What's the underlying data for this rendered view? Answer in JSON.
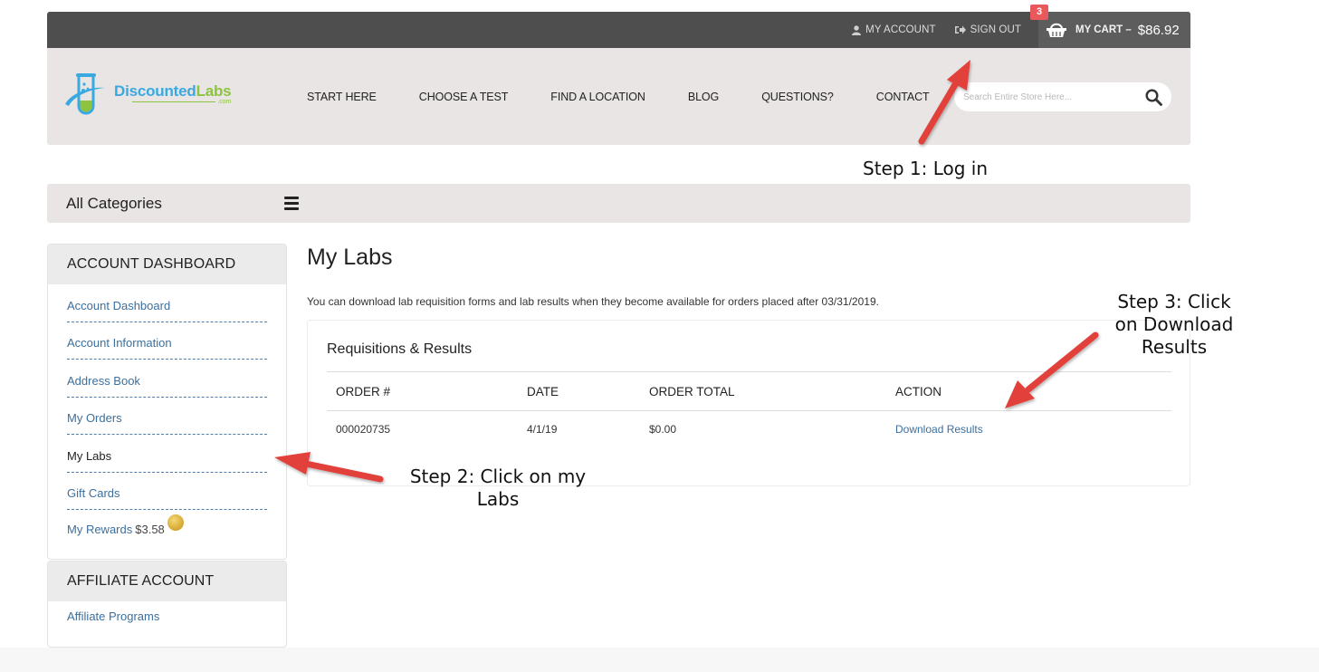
{
  "topbar": {
    "my_account": "MY ACCOUNT",
    "sign_out": "SIGN OUT",
    "cart_label": "MY CART –",
    "cart_total": "$86.92",
    "cart_count": "3"
  },
  "header": {
    "logo": {
      "name_part1": "Discounted",
      "name_part2": "Labs",
      "suffix": ".com"
    },
    "nav": [
      "START HERE",
      "CHOOSE A TEST",
      "FIND A LOCATION",
      "BLOG",
      "QUESTIONS?",
      "CONTACT"
    ],
    "search_placeholder": "Search Entire Store Here..."
  },
  "categories": {
    "label": "All Categories"
  },
  "sidebar": {
    "account": {
      "title": "ACCOUNT DASHBOARD",
      "items": [
        {
          "label": "Account Dashboard",
          "current": false
        },
        {
          "label": "Account Information",
          "current": false
        },
        {
          "label": "Address Book",
          "current": false
        },
        {
          "label": "My Orders",
          "current": false
        },
        {
          "label": "My Labs",
          "current": true
        },
        {
          "label": "Gift Cards",
          "current": false
        },
        {
          "label": "My Rewards",
          "current": false,
          "amount": "$3.58"
        }
      ]
    },
    "affiliate": {
      "title": "AFFILIATE ACCOUNT",
      "items": [
        {
          "label": "Affiliate Programs"
        }
      ]
    }
  },
  "main": {
    "title": "My Labs",
    "intro": "You can download lab requisition forms and lab results when they become available for orders placed after 03/31/2019.",
    "panel_title": "Requisitions & Results",
    "columns": [
      "ORDER #",
      "DATE",
      "ORDER TOTAL",
      "ACTION"
    ],
    "rows": [
      {
        "order": "000020735",
        "date": "4/1/19",
        "total": "$0.00",
        "action": "Download Results"
      }
    ]
  },
  "annotations": {
    "step1": "Step 1: Log in",
    "step2_line1": "Step 2: Click on my",
    "step2_line2": "Labs",
    "step3_line1": "Step 3: Click",
    "step3_line2": "on Download",
    "step3_line3": "Results",
    "arrow_color": "#e2403a"
  }
}
